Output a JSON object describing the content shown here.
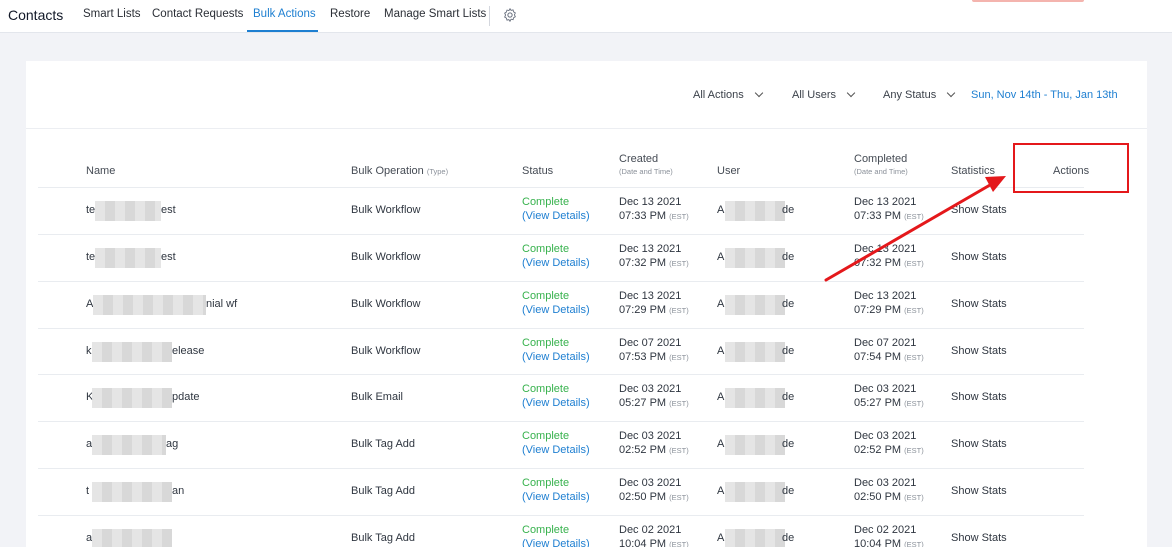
{
  "nav": {
    "brand": "Contacts",
    "tabs": [
      "Smart Lists",
      "Contact Requests",
      "Bulk Actions",
      "Restore",
      "Manage Smart Lists"
    ],
    "active_tab": "Bulk Actions",
    "settings_icon": "gear-icon"
  },
  "filters": {
    "actions": "All Actions",
    "users": "All Users",
    "status": "Any Status",
    "date_range": "Sun, Nov 14th - Thu, Jan 13th"
  },
  "table": {
    "headers": {
      "name": "Name",
      "bulk_operation": "Bulk Operation",
      "bulk_operation_sub": "(Type)",
      "status": "Status",
      "created": "Created",
      "created_sub": "(Date and Time)",
      "user": "User",
      "completed": "Completed",
      "completed_sub": "(Date and Time)",
      "statistics": "Statistics",
      "actions": "Actions"
    },
    "rows": [
      {
        "name_start": "te",
        "name_end": "est",
        "operation": "Bulk Workflow",
        "status": "Complete",
        "details": "(View Details)",
        "created_date": "Dec 13 2021",
        "created_time": "07:33 PM",
        "user_start": "A",
        "user_end": "de",
        "completed_date": "Dec 13 2021",
        "completed_time": "07:33 PM",
        "stats": "Show Stats"
      },
      {
        "name_start": "te",
        "name_end": "est",
        "operation": "Bulk Workflow",
        "status": "Complete",
        "details": "(View Details)",
        "created_date": "Dec 13 2021",
        "created_time": "07:32 PM",
        "user_start": "A",
        "user_end": "de",
        "completed_date": "Dec 13 2021",
        "completed_time": "07:32 PM",
        "stats": "Show Stats"
      },
      {
        "name_start": "A",
        "name_end": "nial wf",
        "operation": "Bulk Workflow",
        "status": "Complete",
        "details": "(View Details)",
        "created_date": "Dec 13 2021",
        "created_time": "07:29 PM",
        "user_start": "A",
        "user_end": "de",
        "completed_date": "Dec 13 2021",
        "completed_time": "07:29 PM",
        "stats": "Show Stats"
      },
      {
        "name_start": "k",
        "name_end": "elease",
        "operation": "Bulk Workflow",
        "status": "Complete",
        "details": "(View Details)",
        "created_date": "Dec 07 2021",
        "created_time": "07:53 PM",
        "user_start": "A",
        "user_end": "de",
        "completed_date": "Dec 07 2021",
        "completed_time": "07:54 PM",
        "stats": "Show Stats"
      },
      {
        "name_start": "K",
        "name_end": "pdate",
        "operation": "Bulk Email",
        "status": "Complete",
        "details": "(View Details)",
        "created_date": "Dec 03 2021",
        "created_time": "05:27 PM",
        "user_start": "A",
        "user_end": "de",
        "completed_date": "Dec 03 2021",
        "completed_time": "05:27 PM",
        "stats": "Show Stats"
      },
      {
        "name_start": "a",
        "name_end": "ag",
        "operation": "Bulk Tag Add",
        "status": "Complete",
        "details": "(View Details)",
        "created_date": "Dec 03 2021",
        "created_time": "02:52 PM",
        "user_start": "A",
        "user_end": "de",
        "completed_date": "Dec 03 2021",
        "completed_time": "02:52 PM",
        "stats": "Show Stats"
      },
      {
        "name_start": "t",
        "name_end": "an",
        "operation": "Bulk Tag Add",
        "status": "Complete",
        "details": "(View Details)",
        "created_date": "Dec 03 2021",
        "created_time": "02:50 PM",
        "user_start": "A",
        "user_end": "de",
        "completed_date": "Dec 03 2021",
        "completed_time": "02:50 PM",
        "stats": "Show Stats"
      },
      {
        "name_start": "a",
        "name_end": "",
        "operation": "Bulk Tag Add",
        "status": "Complete",
        "details": "(View Details)",
        "created_date": "Dec 02 2021",
        "created_time": "10:04 PM",
        "user_start": "A",
        "user_end": "de",
        "completed_date": "Dec 02 2021",
        "completed_time": "10:04 PM",
        "stats": "Show Stats"
      }
    ],
    "timezone": "(EST)"
  },
  "annotation": {
    "highlight_color": "#e4181b"
  }
}
